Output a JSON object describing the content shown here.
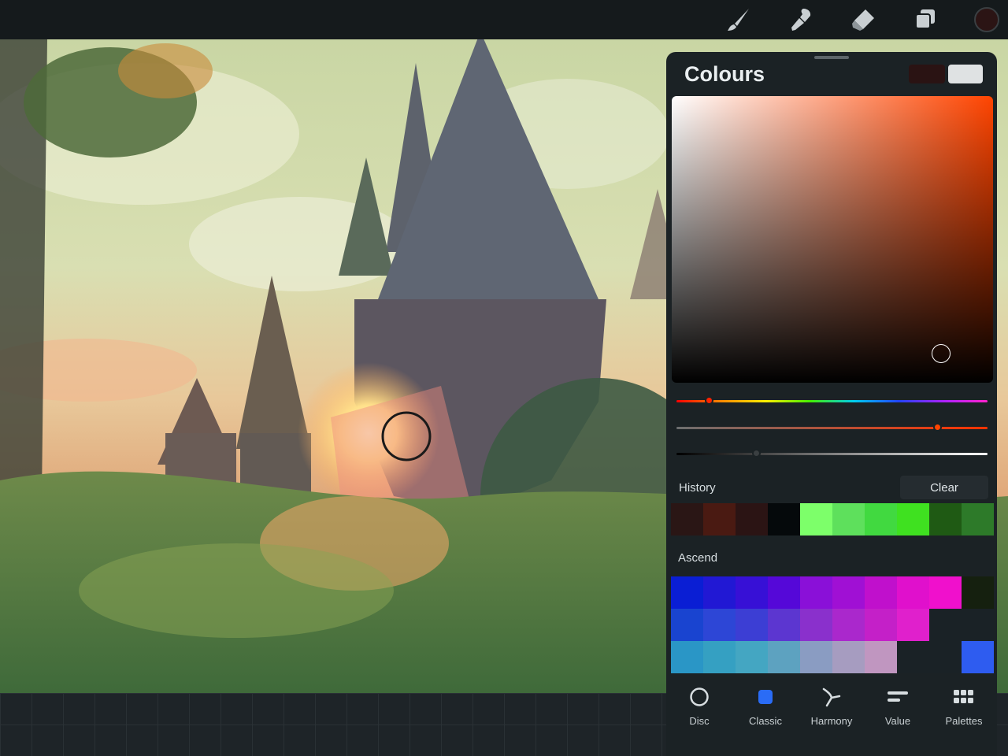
{
  "toolbar": {
    "tools": [
      "brush-icon",
      "smudge-icon",
      "eraser-icon",
      "layers-icon",
      "colour-swatch-icon"
    ],
    "current_colour": "#2b1414"
  },
  "colours_panel": {
    "title": "Colours",
    "primary_colour": "#2a1313",
    "secondary_colour": "#dfe2e3",
    "hue_colour": "#ff4400",
    "sliders": {
      "hue": 0.1,
      "saturation": 0.84,
      "brightness": 0.26
    },
    "history": {
      "label": "History",
      "clear_label": "Clear",
      "swatches": [
        "#2a1615",
        "#4a1a12",
        "#2b1414",
        "#05090b",
        "#7dff6a",
        "#5ee05c",
        "#41d940",
        "#3fe120",
        "#1f5a14",
        "#2d7a29"
      ]
    },
    "palette": {
      "label": "Ascend",
      "rows": [
        [
          "#0a1ed4",
          "#2118d4",
          "#3710d6",
          "#5508d8",
          "#8a10d8",
          "#a010d4",
          "#c010cc",
          "#e010cc",
          "#f010cc",
          "#15200f"
        ],
        [
          "#1944d0",
          "#2d46d6",
          "#3c3ed4",
          "#5c36d0",
          "#8a30cc",
          "#aa28cc",
          "#c420c8",
          "#e020cc",
          "#1a2226",
          "#1a2226"
        ],
        [
          "#2a96c6",
          "#35a0c2",
          "#44a6c2",
          "#5da2c0",
          "#8a9cc2",
          "#a69cc0",
          "#c096c0",
          "#1a2226",
          "#1a2226",
          "#2e5cf0"
        ]
      ]
    },
    "tabs": [
      {
        "label": "Disc",
        "icon": "disc-icon"
      },
      {
        "label": "Classic",
        "icon": "classic-icon"
      },
      {
        "label": "Harmony",
        "icon": "harmony-icon"
      },
      {
        "label": "Value",
        "icon": "value-icon"
      },
      {
        "label": "Palettes",
        "icon": "palettes-icon"
      }
    ],
    "active_tab": "Classic"
  }
}
